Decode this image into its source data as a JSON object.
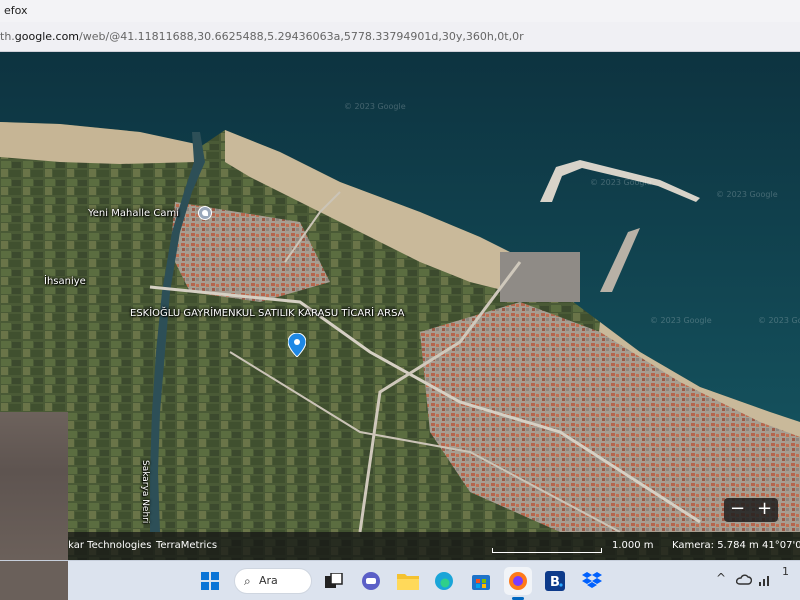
{
  "window": {
    "title": "efox"
  },
  "address_bar": {
    "url_prefix": "th.",
    "url_domain": "google.com",
    "url_rest": "/web/@41.11811688,30.6625488,5.29436063a,5778.33794901d,30y,360h,0t,0r"
  },
  "map": {
    "labels": {
      "mosque": "Yeni Mahalle Cami",
      "village": "İhsaniye",
      "place_name": "ESKİOĞLU GAYRİMENKUL SATILIK KARASU TİCARİ ARSA",
      "river": "Sakarya Nehri"
    },
    "watermarks": [
      "© 2023 Google",
      "© 2023 Google",
      "© 2023 Google",
      "© 2023 Google",
      "© 2023 Google"
    ],
    "icons": {
      "poi": "place-of-worship-icon",
      "pin": "location-pin-icon"
    },
    "colors": {
      "sea": "#0f3a45",
      "shore_sea": "#1b5564",
      "sand": "#c9b99a",
      "farmland": "#4d5e38",
      "pin": "#1e88e5"
    }
  },
  "zoom": {
    "out_label": "−",
    "in_label": "+"
  },
  "attribution": {
    "providers": "akar Technologies",
    "metrics": "TerraMetrics",
    "scale_label": "1.000 m",
    "camera": "Kamera: 5.784 m",
    "coords": "41°07'0"
  },
  "taskbar": {
    "search_label": "Ara",
    "search_glyph": "⌕",
    "tray_overflow": "^",
    "tray_page": "1",
    "apps": [
      "start-icon",
      "search-icon",
      "task-view-icon",
      "chat-icon",
      "file-explorer-icon",
      "edge-icon",
      "store-icon",
      "firefox-icon",
      "booking-icon",
      "dropbox-icon"
    ]
  }
}
